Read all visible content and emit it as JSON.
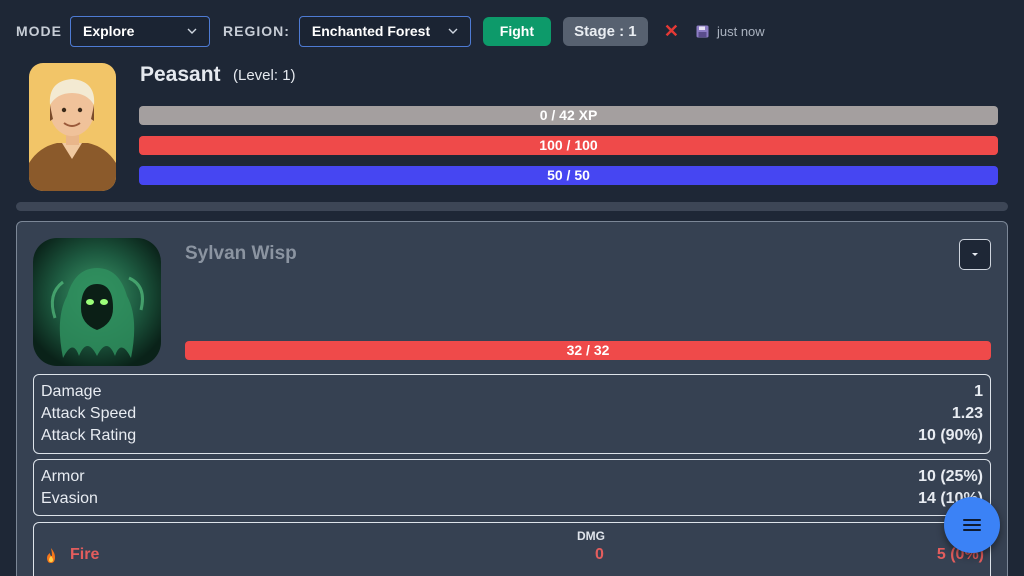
{
  "toolbar": {
    "mode_label": "MODE",
    "mode_value": "Explore",
    "region_label": "REGION:",
    "region_value": "Enchanted Forest",
    "fight_label": "Fight",
    "stage_label": "Stage : 1",
    "save_status": "just now",
    "icons": {
      "close": "close-icon",
      "save": "save-icon",
      "chevron": "chevron-down-icon"
    }
  },
  "player": {
    "name": "Peasant",
    "level": "(Level: 1)",
    "avatar": "peasant-portrait",
    "xp": {
      "text": "0 / 42 XP",
      "fraction": 0,
      "color": "#a49f9f"
    },
    "hp": {
      "text": "100 / 100",
      "fraction": 1,
      "color": "#ef4a4a"
    },
    "mana": {
      "text": "50 / 50",
      "fraction": 1,
      "color": "#4646f2"
    }
  },
  "enemy": {
    "name": "Sylvan Wisp",
    "avatar": "sylvan-wisp-portrait",
    "hp": {
      "text": "32 / 32",
      "fraction": 1,
      "color": "#ef4a4a"
    },
    "offense": [
      {
        "label": "Damage",
        "value": "1"
      },
      {
        "label": "Attack Speed",
        "value": "1.23"
      },
      {
        "label": "Attack Rating",
        "value": "10 (90%)"
      }
    ],
    "defense": [
      {
        "label": "Armor",
        "value": "10 (25%)"
      },
      {
        "label": "Evasion",
        "value": "14 (10%)"
      }
    ],
    "elements_header": "DMG",
    "elements": [
      {
        "icon": "fire-icon",
        "name": "Fire",
        "damage": "0",
        "resist": "5 (0%)"
      }
    ]
  },
  "fab_icon": "hamburger-menu-icon",
  "colors": {
    "accent": "#3b82f6",
    "fight": "#0d9a6a",
    "background": "#1e2736",
    "panel": "#364152"
  }
}
